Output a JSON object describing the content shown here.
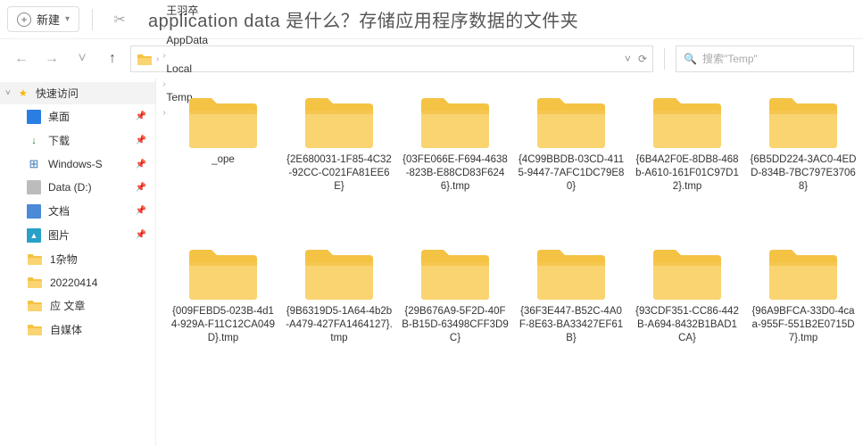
{
  "toolbar": {
    "new_label": "新建"
  },
  "heading": "application data 是什么？存储应用程序数据的文件夹",
  "breadcrumb": [
    "王羽卒",
    "AppData",
    "Local",
    "Temp"
  ],
  "search": {
    "placeholder": "搜索\"Temp\""
  },
  "sidebar": {
    "root": "快速访问",
    "items": [
      {
        "label": "桌面",
        "k": "desktop",
        "pinned": true
      },
      {
        "label": "下载",
        "k": "downloads",
        "pinned": true
      },
      {
        "label": "Windows-S",
        "k": "ws",
        "pinned": true
      },
      {
        "label": "Data (D:)",
        "k": "drive",
        "pinned": true
      },
      {
        "label": "文档",
        "k": "docs",
        "pinned": true
      },
      {
        "label": "图片",
        "k": "pics",
        "pinned": true
      },
      {
        "label": "1杂物",
        "k": "fld",
        "pinned": false
      },
      {
        "label": "20220414",
        "k": "fld",
        "pinned": false
      },
      {
        "label": "应 文章",
        "k": "fld",
        "pinned": false
      },
      {
        "label": "自媒体",
        "k": "fld",
        "pinned": false
      }
    ]
  },
  "folders": [
    "_ope",
    "{2E680031-1F85-4C32-92CC-C021FA81EE6E}",
    "{03FE066E-F694-4638-823B-E88CD83F6246}.tmp",
    "{4C99BBDB-03CD-4115-9447-7AFC1DC79E80}",
    "{6B4A2F0E-8DB8-468b-A610-161F01C97D12}.tmp",
    "{6B5DD224-3AC0-4EDD-834B-7BC797E37068}",
    "{009FEBD5-023B-4d14-929A-F11C12CA049D}.tmp",
    "{9B6319D5-1A64-4b2b-A479-427FA1464127}.tmp",
    "{29B676A9-5F2D-40FB-B15D-63498CFF3D9C}",
    "{36F3E447-B52C-4A0F-8E63-BA33427EF61B}",
    "{93CDF351-CC86-442B-A694-8432B1BAD1CA}",
    "{96A9BFCA-33D0-4caa-955F-551B2E0715D7}.tmp"
  ]
}
